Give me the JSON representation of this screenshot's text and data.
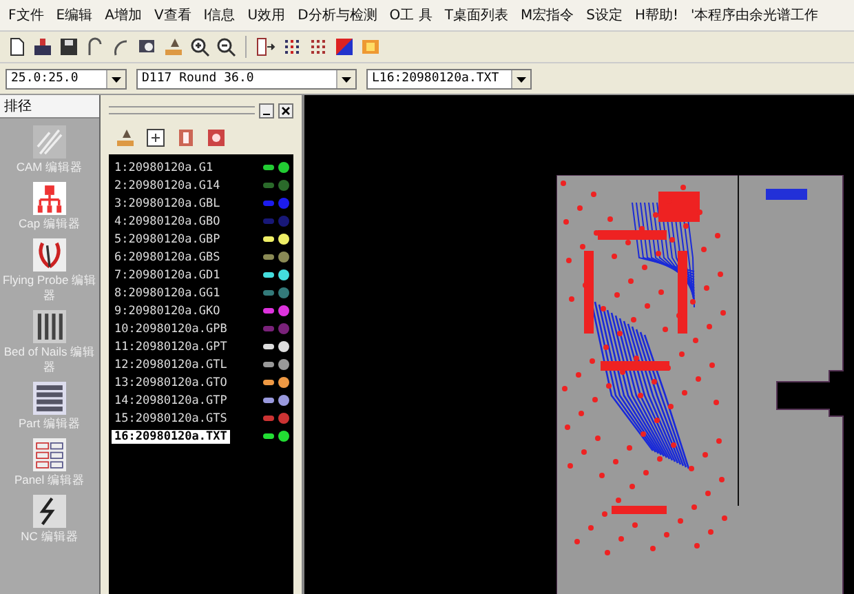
{
  "menu": [
    "F文件",
    "E编辑",
    "A增加",
    "V查看",
    "I信息",
    "U效用",
    "D分析与检测",
    "O工 具",
    "T桌面列表",
    "M宏指令",
    "S设定",
    "H帮助!",
    "'本程序由余光谱工作"
  ],
  "selectors": [
    {
      "value": "25.0:25.0"
    },
    {
      "value": "D117  Round 36.0"
    },
    {
      "value": "L16:20980120a.TXT"
    }
  ],
  "sidebar": {
    "title": "排径",
    "items": [
      {
        "kind": "cam",
        "label": "CAM 编辑器"
      },
      {
        "kind": "cap",
        "label": "Cap 编辑器"
      },
      {
        "kind": "probe",
        "label": "Flying Probe 编辑器"
      },
      {
        "kind": "nails",
        "label": "Bed of Nails 编辑器"
      },
      {
        "kind": "part",
        "label": "Part 编辑器"
      },
      {
        "kind": "panel",
        "label": "Panel 编辑器"
      },
      {
        "kind": "nc",
        "label": "NC 编辑器"
      }
    ]
  },
  "layers": [
    {
      "label": "1:20980120a.G1",
      "color": "#22cc33",
      "selected": false
    },
    {
      "label": "2:20980120a.G14",
      "color": "#2a6a2a",
      "selected": false
    },
    {
      "label": "3:20980120a.GBL",
      "color": "#1c1cee",
      "selected": false
    },
    {
      "label": "4:20980120a.GBO",
      "color": "#181878",
      "selected": false
    },
    {
      "label": "5:20980120a.GBP",
      "color": "#eeee66",
      "selected": false
    },
    {
      "label": "6:20980120a.GBS",
      "color": "#8a8a55",
      "selected": false
    },
    {
      "label": "7:20980120a.GD1",
      "color": "#44dddd",
      "selected": false
    },
    {
      "label": "8:20980120a.GG1",
      "color": "#337a7a",
      "selected": false
    },
    {
      "label": "9:20980120a.GKO",
      "color": "#dd33dd",
      "selected": false
    },
    {
      "label": "10:20980120a.GPB",
      "color": "#7a227a",
      "selected": false
    },
    {
      "label": "11:20980120a.GPT",
      "color": "#dddddd",
      "selected": false
    },
    {
      "label": "12:20980120a.GTL",
      "color": "#999999",
      "selected": false
    },
    {
      "label": "13:20980120a.GTO",
      "color": "#ee9944",
      "selected": false
    },
    {
      "label": "14:20980120a.GTP",
      "color": "#9999dd",
      "selected": false
    },
    {
      "label": "15:20980120a.GTS",
      "color": "#cc3333",
      "selected": false
    },
    {
      "label": "16:20980120a.TXT",
      "color": "#22dd33",
      "selected": true
    }
  ]
}
